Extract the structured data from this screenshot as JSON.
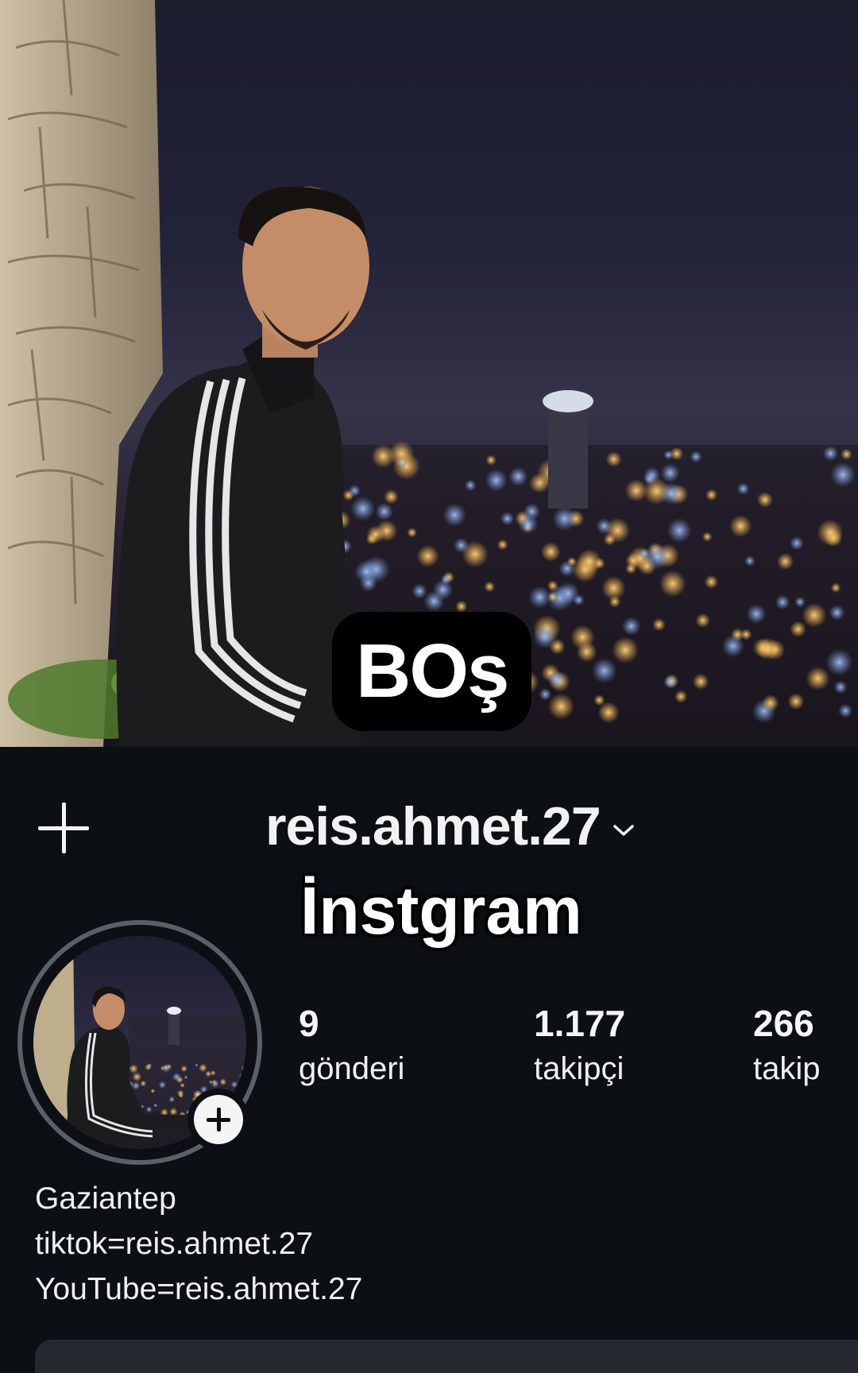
{
  "cover": {
    "caption": "BOş"
  },
  "header": {
    "username": "reis.ahmet.27",
    "overlay_caption": "İnstgram"
  },
  "stats": {
    "posts": {
      "value": "9",
      "label": "gönderi"
    },
    "followers": {
      "value": "1.177",
      "label": "takipçi"
    },
    "following": {
      "value": "266",
      "label": "takip"
    }
  },
  "bio": {
    "lines": [
      "Gaziantep",
      "tiktok=reis.ahmet.27",
      "YouTube=reis.ahmet.27"
    ]
  },
  "icons": {
    "create": "plus-icon",
    "account_switch": "chevron-down-icon",
    "add_story": "plus-icon"
  },
  "colors": {
    "background": "#0c1014",
    "text": "#f5f5f5",
    "ring": "#5a5f6a",
    "card": "#262a30"
  }
}
